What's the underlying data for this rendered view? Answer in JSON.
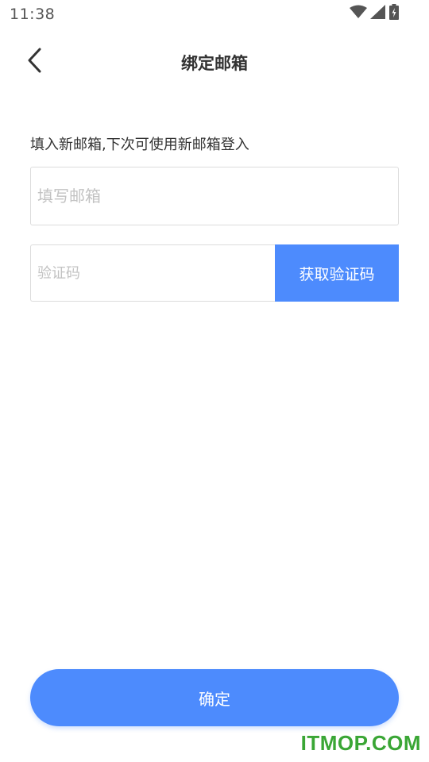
{
  "status_bar": {
    "time": "11:38"
  },
  "header": {
    "title": "绑定邮箱"
  },
  "form": {
    "hint": "填入新邮箱,下次可使用新邮箱登入",
    "email_placeholder": "填写邮箱",
    "code_placeholder": "验证码",
    "get_code_label": "获取验证码",
    "confirm_label": "确定"
  },
  "watermark": "ITMOP.COM",
  "colors": {
    "accent": "#4d8bfd",
    "title_text": "#333333",
    "placeholder": "#c2c2c2",
    "border": "#dcdcdc",
    "watermark": "#3aa635"
  },
  "icons": {
    "status": [
      "wifi-icon",
      "cellular-signal-icon",
      "battery-charging-icon"
    ],
    "back": "back-arrow-icon"
  }
}
